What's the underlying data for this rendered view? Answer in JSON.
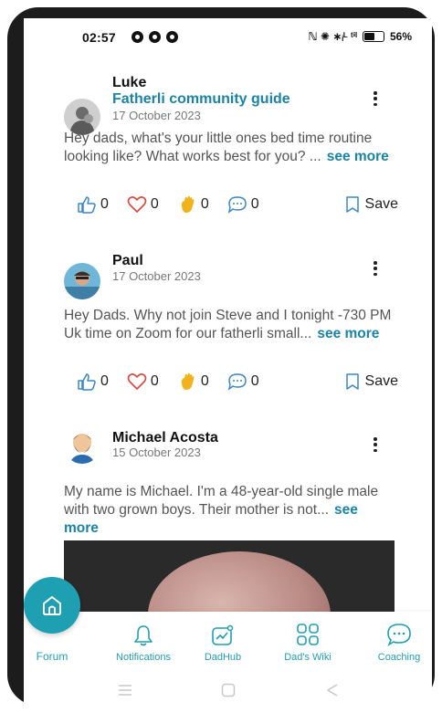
{
  "status_bar": {
    "time": "02:57",
    "signal_text": "ℕ ✺ ∗ᵢᴸ ᵗⁱˡ",
    "battery": "56%",
    "battery_level": 0.56
  },
  "posts": [
    {
      "author": "Luke",
      "group": "Fatherli community guide",
      "date": "17 October 2023",
      "text": "Hey dads, what's your little ones bed time routine looking like? What works best for you? ...",
      "see_more": "see more",
      "likes": "0",
      "hearts": "0",
      "claps": "0",
      "comments": "0",
      "save_label": "Save"
    },
    {
      "author": "Paul",
      "date": "17 October 2023",
      "text": "Hey Dads. Why not join Steve and I tonight -730 PM Uk time on Zoom for our fatherli small...",
      "see_more": "see more",
      "likes": "0",
      "hearts": "0",
      "claps": "0",
      "comments": "0",
      "save_label": "Save"
    },
    {
      "author": "Michael Acosta",
      "date": "15 October 2023",
      "text": "My name is Michael. I'm a 48-year-old single male with two grown boys. Their mother is not...",
      "see_more": "see more"
    }
  ],
  "nav": {
    "forum": "Forum",
    "notifications": "Notifications",
    "dadhub": "DadHub",
    "wiki": "Dad's Wiki",
    "coaching": "Coaching"
  },
  "colors": {
    "accent": "#1f9fb2",
    "link": "#1a83a8",
    "heart": "#e0443c",
    "clap": "#f2b21b"
  }
}
